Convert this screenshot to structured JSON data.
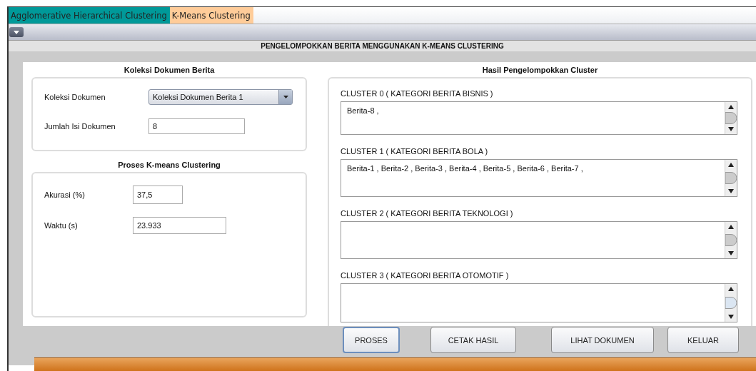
{
  "tabs": [
    {
      "label": "Agglomerative Hierarchical Clustering",
      "selected": false
    },
    {
      "label": "K-Means Clustering",
      "selected": true
    }
  ],
  "title": "PENGELOMPOKKAN BERITA MENGGUNAKAN K-MEANS CLUSTERING",
  "groups": [
    {
      "title": "Koleksi Dokumen Berita",
      "fields": [
        {
          "label": "Koleksi Dokumen",
          "kind": "dropdown",
          "value": "Koleksi Dokumen Berita 1"
        },
        {
          "label": "Jumlah Isi Dokumen",
          "kind": "text",
          "value": "8"
        }
      ]
    },
    {
      "title": "Proses K-means Clustering",
      "fields": [
        {
          "label": "Akurasi (%)",
          "kind": "text",
          "value": "37,5"
        },
        {
          "label": "Waktu (s)",
          "kind": "text",
          "value": "23.933"
        }
      ]
    }
  ],
  "results": {
    "title": "Hasil Pengelompokkan Cluster",
    "clusters": [
      {
        "label": "CLUSTER 0 ( KATEGORI BERITA BISNIS )",
        "value": "Berita-8 ,"
      },
      {
        "label": "CLUSTER 1 ( KATEGORI BERITA BOLA )",
        "value": "Berita-1 , Berita-2 , Berita-3 , Berita-4 , Berita-5 , Berita-6 , Berita-7 ,"
      },
      {
        "label": "CLUSTER 2 ( KATEGORI BERITA TEKNOLOGI )"
      },
      {
        "label": "CLUSTER 3 ( KATEGORI BERITA OTOMOTIF )"
      }
    ]
  },
  "buttons": [
    {
      "label": "PROSES",
      "focused": true
    },
    {
      "label": "CETAK HASIL",
      "focused": false
    },
    {
      "label": "LIHAT DOKUMEN",
      "focused": false
    },
    {
      "label": "KELUAR",
      "focused": false
    }
  ]
}
